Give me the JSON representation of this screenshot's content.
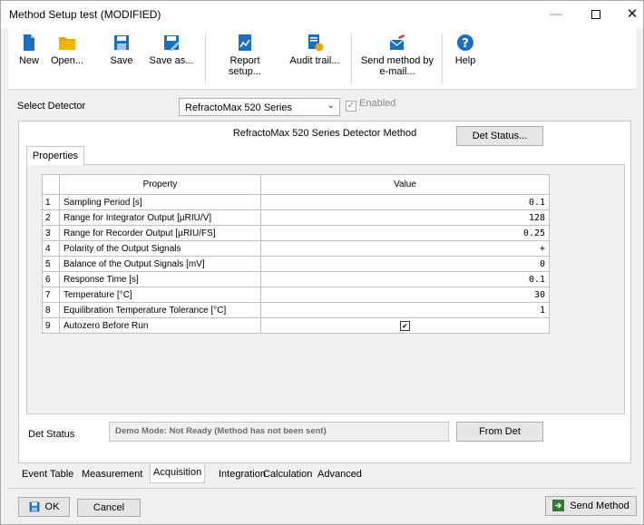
{
  "window": {
    "title": "Method Setup test (MODIFIED)"
  },
  "toolbar": {
    "new": "New",
    "open": "Open...",
    "save": "Save",
    "save_as": "Save as...",
    "report_setup": "Report setup...",
    "audit_trail": "Audit trail...",
    "send_method_line1": "Send method by",
    "send_method_line2": "e-mail...",
    "help": "Help"
  },
  "detector": {
    "label": "Select Detector",
    "selected": "RefractoMax 520 Series",
    "enabled_label": "Enabled",
    "enabled_checked": true
  },
  "method_panel": {
    "title": "RefractoMax 520 Series Detector Method",
    "det_status_button": "Det Status...",
    "properties_tab": "Properties"
  },
  "properties_table": {
    "header_property": "Property",
    "header_value": "Value",
    "rows": [
      {
        "num": "1",
        "name": "Sampling Period [s]",
        "value": "0.1"
      },
      {
        "num": "2",
        "name": "Range for Integrator Output [µRIU/V]",
        "value": "128"
      },
      {
        "num": "3",
        "name": "Range for Recorder Output [µRIU/FS]",
        "value": "0.25"
      },
      {
        "num": "4",
        "name": "Polarity of the Output Signals",
        "value": "+"
      },
      {
        "num": "5",
        "name": "Balance of the Output Signals [mV]",
        "value": "0"
      },
      {
        "num": "6",
        "name": "Response Time [s]",
        "value": "0.1"
      },
      {
        "num": "7",
        "name": "Temperature [°C]",
        "value": "30"
      },
      {
        "num": "8",
        "name": "Equilibration Temperature Tolerance [°C]",
        "value": "1"
      },
      {
        "num": "9",
        "name": "Autozero Before Run",
        "value": "",
        "checkbox": true
      }
    ]
  },
  "status": {
    "label": "Det Status",
    "text": "Demo Mode: Not Ready (Method has not been sent)",
    "from_det_button": "From Det"
  },
  "bottom_tabs": [
    "Event Table",
    "Measurement",
    "Acquisition",
    "Integration",
    "Calculation",
    "Advanced"
  ],
  "active_tab": "Acquisition",
  "footer": {
    "ok": "OK",
    "cancel": "Cancel",
    "send_method": "Send Method"
  },
  "colors": {
    "accent_blue": "#1c6fbf",
    "icon_yellow": "#e9a800",
    "green": "#3a8f3a"
  }
}
